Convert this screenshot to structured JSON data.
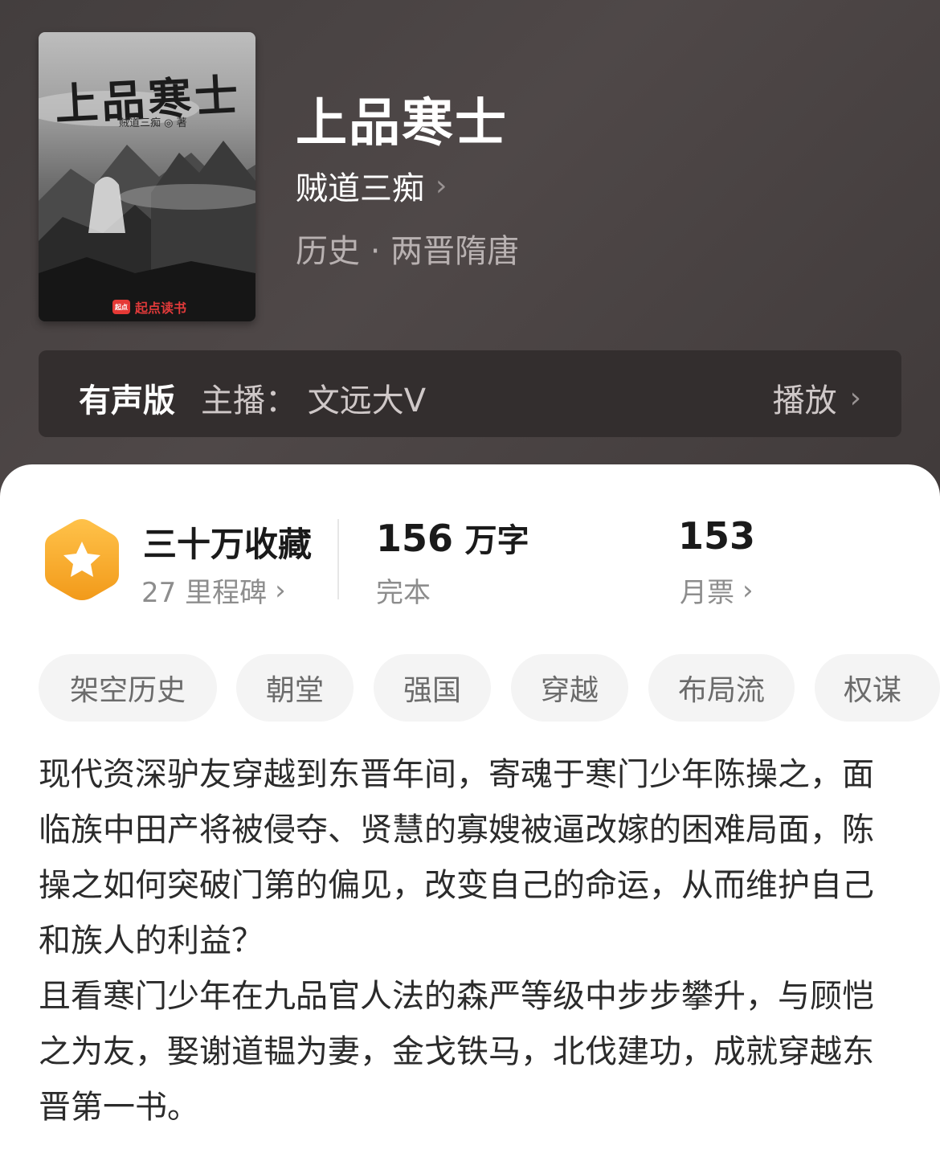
{
  "colors": {
    "header_bg": "#4a4343",
    "audio_bar_bg": "#332e2e",
    "badge": "#f5a623",
    "tag_bg": "#f4f4f4"
  },
  "cover": {
    "title": "上品寒士",
    "author": "贼道三痴 ◎ 著",
    "publisher": "起点读书",
    "publisher_logo": "起点"
  },
  "book": {
    "title": "上品寒士",
    "author": "贼道三痴",
    "category": "历史 · 两晋隋唐"
  },
  "audio": {
    "label": "有声版",
    "anchor": "主播：  文远大V",
    "action": "播放"
  },
  "stats": {
    "favorites": {
      "main": "三十万收藏",
      "sub": "27 里程碑",
      "icon": "star-badge-icon"
    },
    "words": {
      "number": "156",
      "unit": "万字",
      "sub": "完本"
    },
    "tickets": {
      "number": "153",
      "sub": "月票"
    }
  },
  "tags": [
    "架空历史",
    "朝堂",
    "强国",
    "穿越",
    "布局流",
    "权谋"
  ],
  "description": {
    "para1": "现代资深驴友穿越到东晋年间，寄魂于寒门少年陈操之，面临族中田产将被侵夺、贤慧的寡嫂被逼改嫁的困难局面，陈操之如何突破门第的偏见，改变自己的命运，从而维护自己和族人的利益？",
    "para2": "且看寒门少年在九品官人法的森严等级中步步攀升，与顾恺之为友，娶谢道韫为妻，金戈铁马，北伐建功，成就穿越东晋第一书。"
  }
}
